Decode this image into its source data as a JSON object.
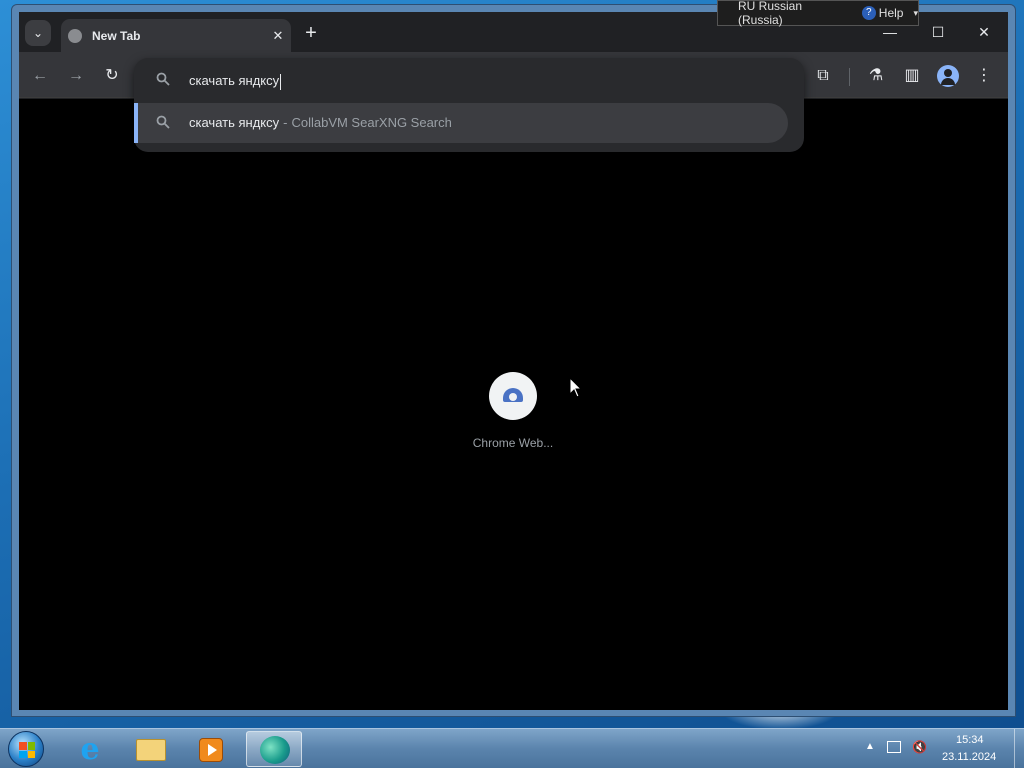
{
  "browser": {
    "tab": {
      "title": "New Tab",
      "close_glyph": "✕"
    },
    "new_tab_glyph": "+",
    "tab_search_glyph": "⌄",
    "window_controls": {
      "minimize": "—",
      "maximize": "☐",
      "close": "✕"
    },
    "toolbar": {
      "back_glyph": "←",
      "forward_glyph": "→",
      "reload_glyph": "↻",
      "extensions_glyph": "⧉",
      "labs_glyph": "⚗",
      "side_panel_glyph": "▥",
      "menu_glyph": "⋮"
    },
    "omnibox": {
      "search_glyph": "🔍",
      "value": "скачать яндксу",
      "suggestion": {
        "query": "скачать яндксу",
        "separator": "-",
        "engine": "CollabVM SearXNG Search"
      }
    },
    "new_tab_page": {
      "shortcut_label": "Chrome Web..."
    }
  },
  "language_bar": {
    "language": "RU Russian (Russia)",
    "help_glyph": "?",
    "help": "Help",
    "menu_glyph": "▾"
  },
  "taskbar": {
    "apps": [
      "internet-explorer",
      "file-explorer",
      "windows-media-player",
      "edge"
    ],
    "ie_glyph": "e",
    "tray": {
      "arrow_glyph": "▲",
      "volume_glyph": "🔇",
      "time": "15:34",
      "date": "23.11.2024"
    }
  },
  "colors": {
    "browser_bg": "#202124",
    "toolbar_bg": "#35363a",
    "accent": "#8ab4f8",
    "taskbar": "#5b84ad"
  }
}
